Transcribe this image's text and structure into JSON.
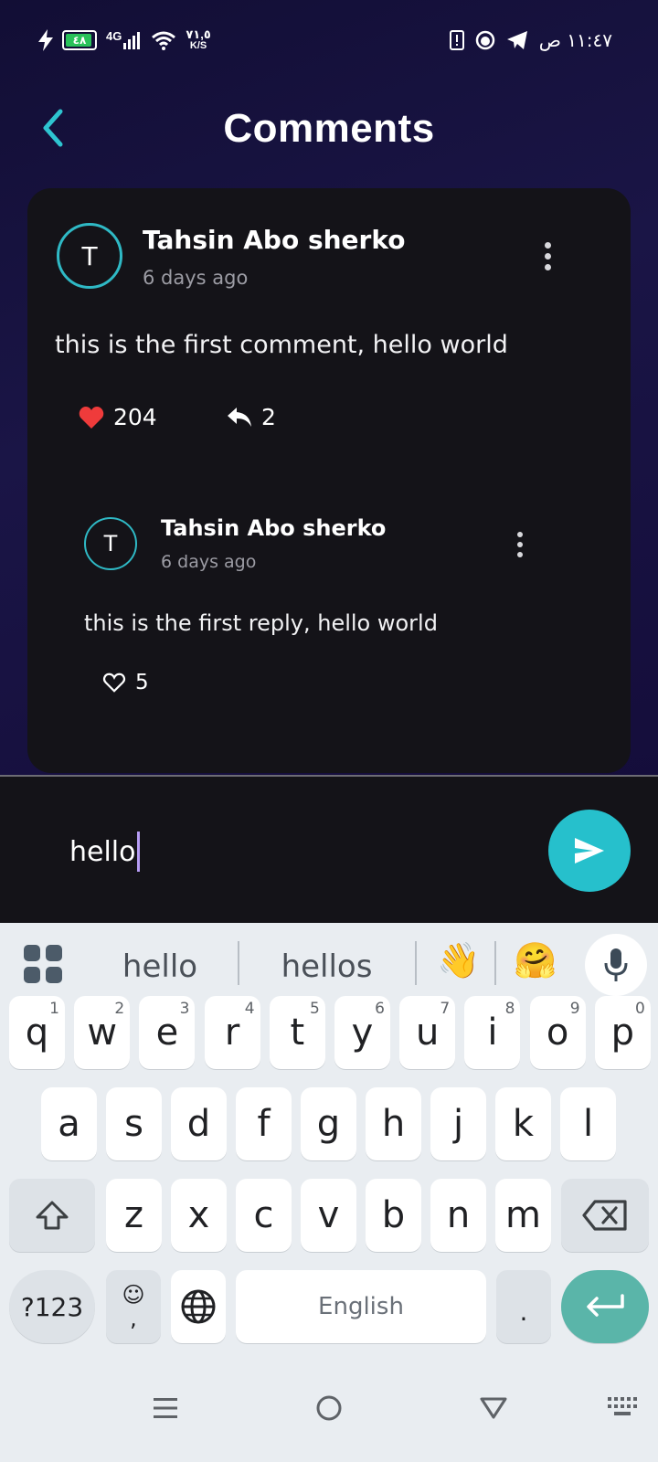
{
  "status_bar": {
    "battery_level": "٤٨",
    "network": "4G",
    "speed_value": "٧١,٥",
    "speed_unit": "K/S",
    "time": "١١:٤٧ ص"
  },
  "header": {
    "title": "Comments"
  },
  "comment": {
    "avatar_initial": "T",
    "author": "Tahsin Abo sherko",
    "time_ago": "6 days ago",
    "text": "this is the first comment, hello world",
    "likes": "204",
    "replies": "2",
    "like_color": "#ef3b3b",
    "reply": {
      "avatar_initial": "T",
      "author": "Tahsin Abo sherko",
      "time_ago": "6 days ago",
      "text": "this is the first reply, hello world",
      "likes": "5"
    }
  },
  "compose": {
    "value": "hello",
    "accent": "#26c0cc"
  },
  "keyboard": {
    "suggestions": [
      "hello",
      "hellos"
    ],
    "emoji_suggestions": [
      "👋",
      "🤗"
    ],
    "row1": [
      {
        "key": "q",
        "hint": "1"
      },
      {
        "key": "w",
        "hint": "2"
      },
      {
        "key": "e",
        "hint": "3"
      },
      {
        "key": "r",
        "hint": "4"
      },
      {
        "key": "t",
        "hint": "5"
      },
      {
        "key": "y",
        "hint": "6"
      },
      {
        "key": "u",
        "hint": "7"
      },
      {
        "key": "i",
        "hint": "8"
      },
      {
        "key": "o",
        "hint": "9"
      },
      {
        "key": "p",
        "hint": "0"
      }
    ],
    "row2": [
      "a",
      "s",
      "d",
      "f",
      "g",
      "h",
      "j",
      "k",
      "l"
    ],
    "row3": [
      "z",
      "x",
      "c",
      "v",
      "b",
      "n",
      "m"
    ],
    "symbols_label": "?123",
    "emoji_key_top": "☺",
    "emoji_key_bottom": ",",
    "space_label": "English",
    "period_label": "."
  }
}
